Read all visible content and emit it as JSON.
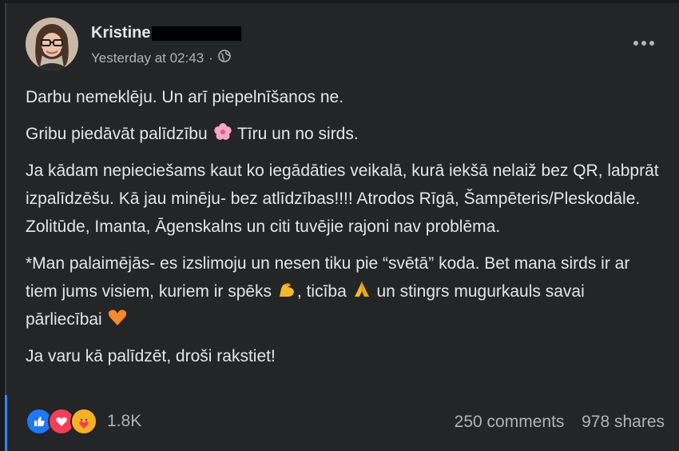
{
  "post": {
    "author_name": "Kristine",
    "timestamp": "Yesterday at 02:43",
    "separator": "·",
    "privacy_icon": "globe-icon",
    "paragraphs": {
      "p1": "Darbu nemeklēju. Un arī piepelnīšanos ne.",
      "p2a": "Gribu piedāvāt palīdzību",
      "p2b": "Tīru un no sirds.",
      "p3": "Ja kādam nepieciešams kaut ko iegādāties veikalā, kurā iekšā nelaiž bez QR, labprāt izpalīdzēšu. Kā jau minēju- bez atlīdzības!!!!  Atrodos Rīgā, Šampēteris/Pleskodāle. Zolitūde, Imanta, Āgenskalns un citi tuvējie rajoni nav problēma.",
      "p4a": "*Man palaimējās- es izslimoju un nesen tiku pie “svētā” koda. Bet mana sirds ir ar tiem jums visiem, kuriem ir spēks",
      "p4b": ", ticība",
      "p4c": "un stingrs mugurkauls savai pārliecībai",
      "p5": "Ja varu kā palīdzēt, droši rakstiet!"
    },
    "emojis": [
      "cherry-blossom-icon",
      "flexed-biceps-icon",
      "folded-hands-icon",
      "orange-heart-icon"
    ]
  },
  "footer": {
    "reaction_icons": [
      "like-icon",
      "love-icon",
      "care-icon"
    ],
    "reaction_count": "1.8K",
    "comments": "250 comments",
    "shares": "978 shares"
  },
  "colors": {
    "card_bg": "#242526",
    "page_bg": "#18191a",
    "text_primary": "#e4e6eb",
    "text_secondary": "#b0b3b8",
    "like_blue": "#2078f4",
    "love_red": "#f33e58",
    "care_yellow": "#f7b125"
  }
}
